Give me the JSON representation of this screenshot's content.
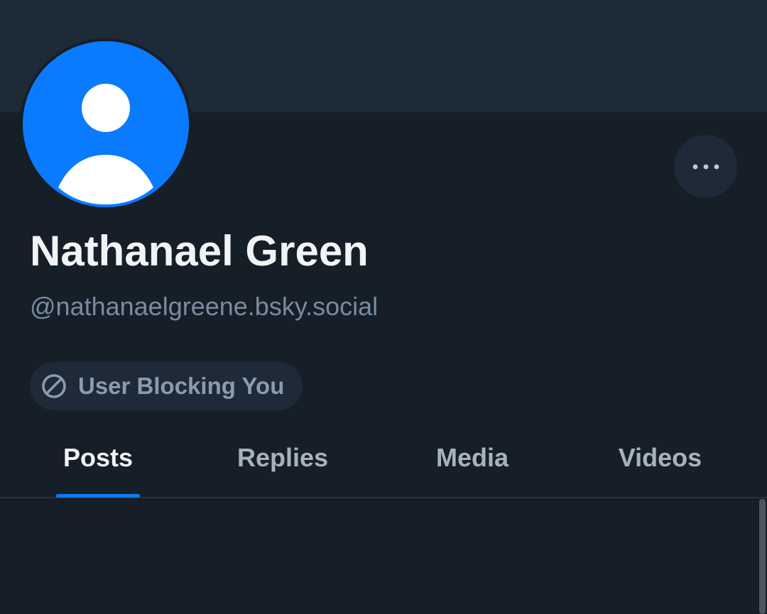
{
  "profile": {
    "display_name": "Nathanael Green",
    "handle": "@nathanaelgreene.bsky.social",
    "avatar_icon": "default-avatar-icon",
    "more_icon": "ellipsis-icon"
  },
  "badge": {
    "label": "User Blocking You",
    "icon": "block-icon"
  },
  "tabs": [
    {
      "label": "Posts",
      "active": true
    },
    {
      "label": "Replies",
      "active": false
    },
    {
      "label": "Media",
      "active": false
    },
    {
      "label": "Videos",
      "active": false
    }
  ],
  "colors": {
    "accent": "#0a7aff",
    "background": "#161e27",
    "banner": "#1d2a38",
    "muted_text": "#788ca1"
  }
}
